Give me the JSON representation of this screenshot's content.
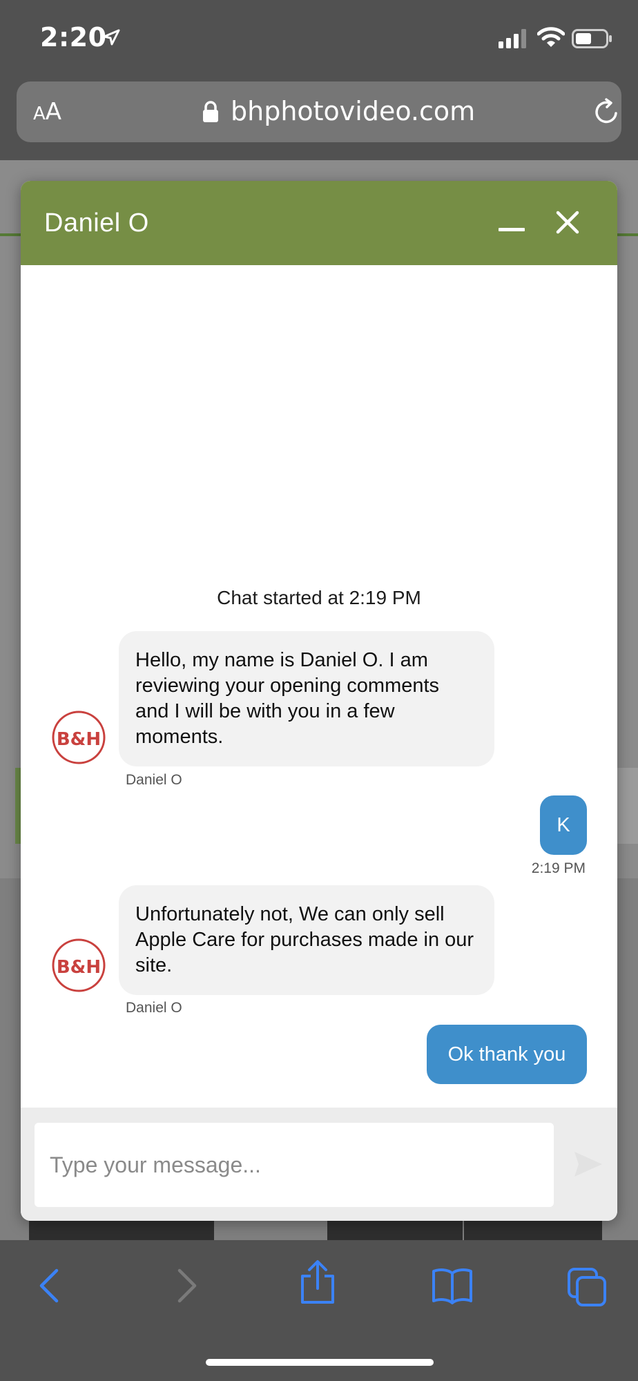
{
  "status_bar": {
    "time": "2:20"
  },
  "url_bar": {
    "text_size_label_small": "A",
    "text_size_label_large": "A",
    "url": "bhphotovideo.com"
  },
  "chat": {
    "agent_name": "Daniel O",
    "header_color": "#768e45",
    "chat_started": "Chat started at 2:19 PM",
    "messages": [
      {
        "from": "agent",
        "text": "Hello, my name is Daniel O. I am reviewing your opening comments and I will be with you in a few moments.",
        "sender": "Daniel O",
        "avatar_text": "B&H"
      },
      {
        "from": "user",
        "text": "K",
        "time": "2:19 PM"
      },
      {
        "from": "agent",
        "text": "Unfortunately not, We can only sell Apple Care for purchases made in our site.",
        "sender": "Daniel O",
        "avatar_text": "B&H"
      },
      {
        "from": "user",
        "text": "Ok thank you"
      }
    ],
    "input": {
      "placeholder": "Type your message...",
      "value": ""
    },
    "user_bubble_color": "#3f8fcb"
  },
  "toolbar": {
    "icons": [
      "back-icon",
      "forward-icon",
      "share-icon",
      "bookmarks-icon",
      "tabs-icon"
    ]
  }
}
